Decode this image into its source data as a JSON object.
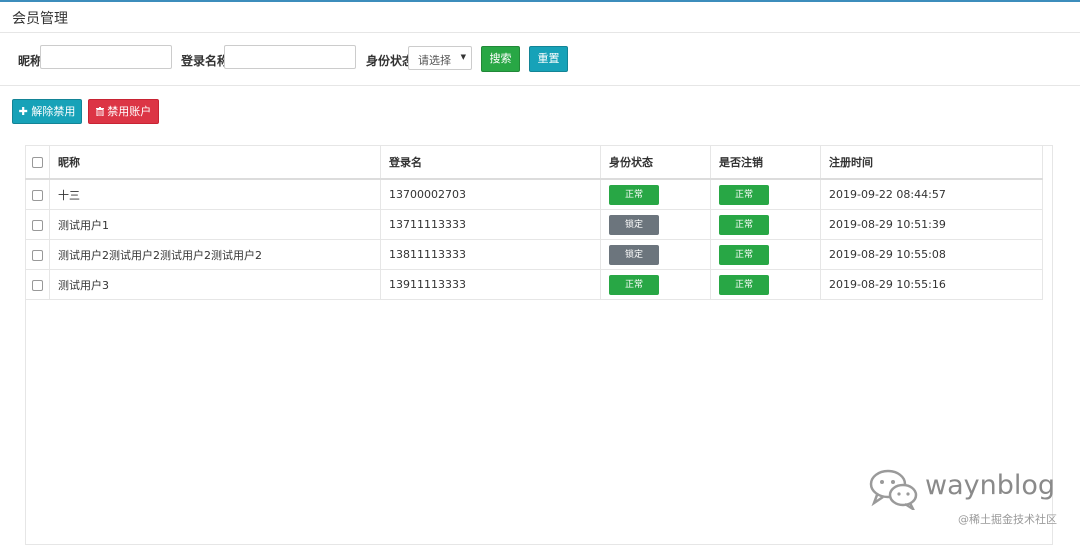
{
  "header": {
    "title": "会员管理"
  },
  "search": {
    "nickname_label": "昵称",
    "nickname_value": "",
    "login_label": "登录名称",
    "login_value": "",
    "status_label": "身份状态",
    "status_selected": "请选择",
    "search_button": "搜索",
    "reset_button": "重置"
  },
  "toolbar": {
    "unban_label": "解除禁用",
    "ban_label": "禁用账户"
  },
  "table": {
    "columns": [
      "昵称",
      "登录名",
      "身份状态",
      "是否注销",
      "注册时间"
    ],
    "rows": [
      {
        "nickname": "十三",
        "login": "13700002703",
        "status": "正常",
        "status_type": "normal",
        "cancel": "正常",
        "time": "2019-09-22 08:44:57"
      },
      {
        "nickname": "测试用户1",
        "login": "13711113333",
        "status": "锁定",
        "status_type": "locked",
        "cancel": "正常",
        "time": "2019-08-29 10:51:39"
      },
      {
        "nickname": "测试用户2测试用户2测试用户2测试用户2",
        "login": "13811113333",
        "status": "锁定",
        "status_type": "locked",
        "cancel": "正常",
        "time": "2019-08-29 10:55:08"
      },
      {
        "nickname": "测试用户3",
        "login": "13911113333",
        "status": "正常",
        "status_type": "normal",
        "cancel": "正常",
        "time": "2019-08-29 10:55:16"
      }
    ]
  },
  "watermark": {
    "brand": "waynblog",
    "sub": "@稀土掘金技术社区",
    "icon": "wechat-icon"
  },
  "colors": {
    "green": "#28a745",
    "teal": "#17a2b8",
    "red": "#dc3545",
    "gray": "#6c757d"
  }
}
